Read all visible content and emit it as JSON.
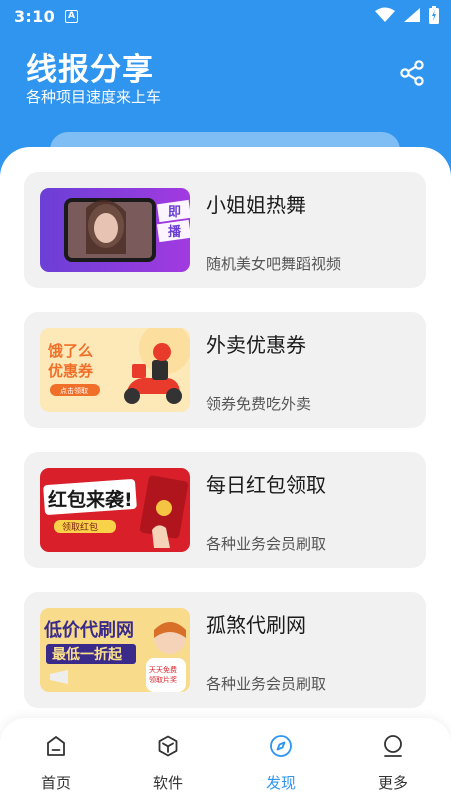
{
  "status_bar": {
    "time": "3:10",
    "indicator": "A"
  },
  "header": {
    "title": "线报分享",
    "subtitle": "各种项目速度来上车",
    "share_icon": "share-icon"
  },
  "cards": [
    {
      "title": "小姐姐热舞",
      "description": "随机美女吧舞蹈视频",
      "thumb_text": [
        "即",
        "播"
      ]
    },
    {
      "title": "外卖优惠券",
      "description": "领券免费吃外卖",
      "thumb_text": [
        "饿了么",
        "优惠券",
        "点击领取"
      ]
    },
    {
      "title": "每日红包领取",
      "description": "各种业务会员刷取",
      "thumb_text": [
        "红包来袭!",
        "领取红包"
      ]
    },
    {
      "title": "孤煞代刷网",
      "description": "各种业务会员刷取",
      "thumb_text": [
        "低价代刷网",
        "最低一折起",
        "天天免费",
        "领取片奖"
      ]
    }
  ],
  "bottom_nav": [
    {
      "label": "首页",
      "icon": "home-icon",
      "active": false
    },
    {
      "label": "软件",
      "icon": "cube-icon",
      "active": false
    },
    {
      "label": "发现",
      "icon": "compass-icon",
      "active": true
    },
    {
      "label": "更多",
      "icon": "profile-icon",
      "active": false
    }
  ],
  "colors": {
    "primary": "#2f95ef",
    "card_bg": "#f1f1f1"
  }
}
